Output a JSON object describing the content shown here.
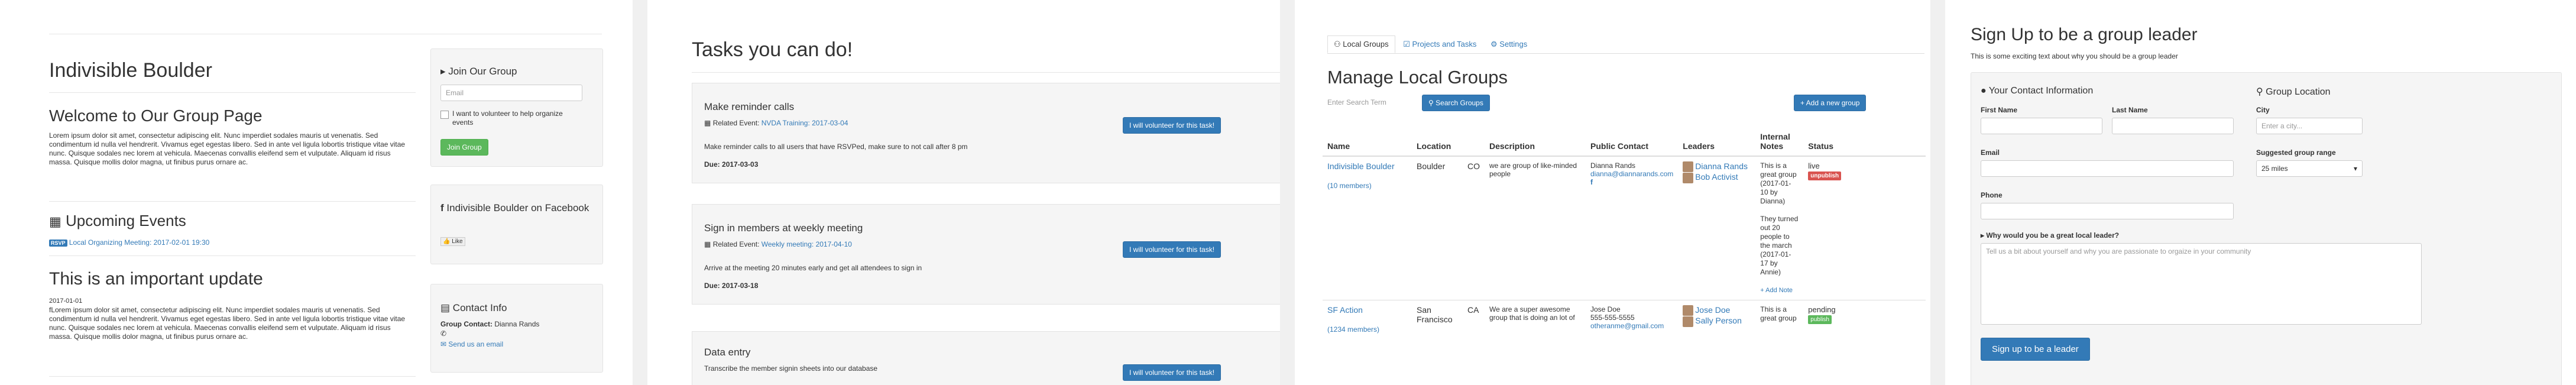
{
  "panel1": {
    "org_title": "Indivisible Boulder",
    "welcome_heading": "Welcome to Our Group Page",
    "welcome_body": "Lorem ipsum dolor sit amet, consectetur adipiscing elit. Nunc imperdiet sodales mauris ut venenatis. Sed condimentum id nulla vel hendrerit. Vivamus eget egestas libero. Sed in ante vel ligula lobortis tristique vitae vitae nunc. Quisque sodales nec lorem at vehicula. Maecenas convallis eleifend sem et vulputate. Aliquam id risus massa. Quisque mollis dolor magna, ut finibus purus ornare ac.",
    "events_heading": "Upcoming Events",
    "event_badge": "RSVP",
    "event_link": "Local Organizing Meeting: 2017-02-01 19:30",
    "update_heading": "This is an important update",
    "update_date": "2017-01-01",
    "update_body": "fLorem ipsum dolor sit amet, consectetur adipiscing elit. Nunc imperdiet sodales mauris ut venenatis. Sed condimentum id nulla vel hendrerit. Vivamus eget egestas libero. Sed in ante vel ligula lobortis tristique vitae vitae nunc. Quisque sodales nec lorem at vehicula. Maecenas convallis eleifend sem et vulputate. Aliquam id risus massa. Quisque mollis dolor magna, ut finibus purus ornare ac.",
    "join": {
      "title": "Join Our Group",
      "email_placeholder": "Email",
      "checkbox_label": "I want to volunteer to help organize events",
      "button": "Join Group"
    },
    "facebook": {
      "title": "Indivisible Boulder on Facebook",
      "like": "Like"
    },
    "contact": {
      "title": "Contact Info",
      "label": "Group Contact:",
      "name": "Dianna Rands",
      "email_link": "Send us an email"
    }
  },
  "panel2": {
    "heading": "Tasks you can do!",
    "related_label": "Related Event:",
    "due_label": "Due:",
    "volunteer_button": "I will volunteer for this task!",
    "tasks": [
      {
        "title": "Make reminder calls",
        "event": "NVDA Training: 2017-03-04",
        "desc": "Make reminder calls to all users that have RSVPed, make sure to not call after 8 pm",
        "due": "2017-03-03"
      },
      {
        "title": "Sign in members at weekly meeting",
        "event": "Weekly meeting: 2017-04-10",
        "desc": "Arrive at the meeting 20 minutes early and get all attendees to sign in",
        "due": "2017-03-18"
      },
      {
        "title": "Data entry",
        "event": "",
        "desc": "Transcribe the member signin sheets into our database",
        "due": ""
      }
    ]
  },
  "panel3": {
    "tabs": [
      "Local Groups",
      "Projects and Tasks",
      "Settings"
    ],
    "heading": "Manage Local Groups",
    "search_placeholder": "Enter Search Term",
    "search_button": "Search Groups",
    "add_button": "+ Add a new group",
    "columns": [
      "Name",
      "Location",
      "",
      "Description",
      "Public Contact",
      "Leaders",
      "Internal Notes",
      "Status"
    ],
    "rows": [
      {
        "name": "Indivisible Boulder",
        "members": "(10 members)",
        "city": "Boulder",
        "state": "CO",
        "description": "we are group of like-minded people",
        "contact_name": "Dianna Rands",
        "contact_email": "dianna@diannarands.com",
        "contact_phone": "",
        "leaders": [
          "Dianna Rands",
          "Bob Activist"
        ],
        "notes": [
          "This is a great group (2017-01-10 by Dianna)",
          "They turned out 20 people to the march (2017-01-17 by Annie)"
        ],
        "add_note": "+ Add Note",
        "status": "live",
        "status_badge": "unpublish"
      },
      {
        "name": "SF Action",
        "members": "(1234 members)",
        "city": "San Francisco",
        "state": "CA",
        "description": "We are a super awesome group that is doing an lot of",
        "contact_name": "Jose Doe",
        "contact_email": "otheranme@gmail.com",
        "contact_phone": "555-555-5555",
        "leaders": [
          "Jose Doe",
          "Sally Person"
        ],
        "notes": [
          "This is a great group"
        ],
        "add_note": "",
        "status": "pending",
        "status_badge": "publish"
      }
    ]
  },
  "panel4": {
    "heading": "Sign Up to be a group leader",
    "intro": "This is some exciting text about why you should be a group leader",
    "contact_title": "Your Contact Information",
    "location_title": "Group Location",
    "first_name": "First Name",
    "last_name": "Last Name",
    "email": "Email",
    "phone": "Phone",
    "city": "City",
    "city_placeholder": "Enter a city...",
    "range_label": "Suggested group range",
    "range_value": "25 miles",
    "why_label": "Why would you be a great local leader?",
    "why_placeholder": "Tell us a bit about yourself and why you are passionate to orgaize in your community",
    "submit": "Sign up to be a leader"
  },
  "colors": {
    "link": "#337ab7",
    "success": "#5cb85c",
    "danger": "#d9534f"
  }
}
